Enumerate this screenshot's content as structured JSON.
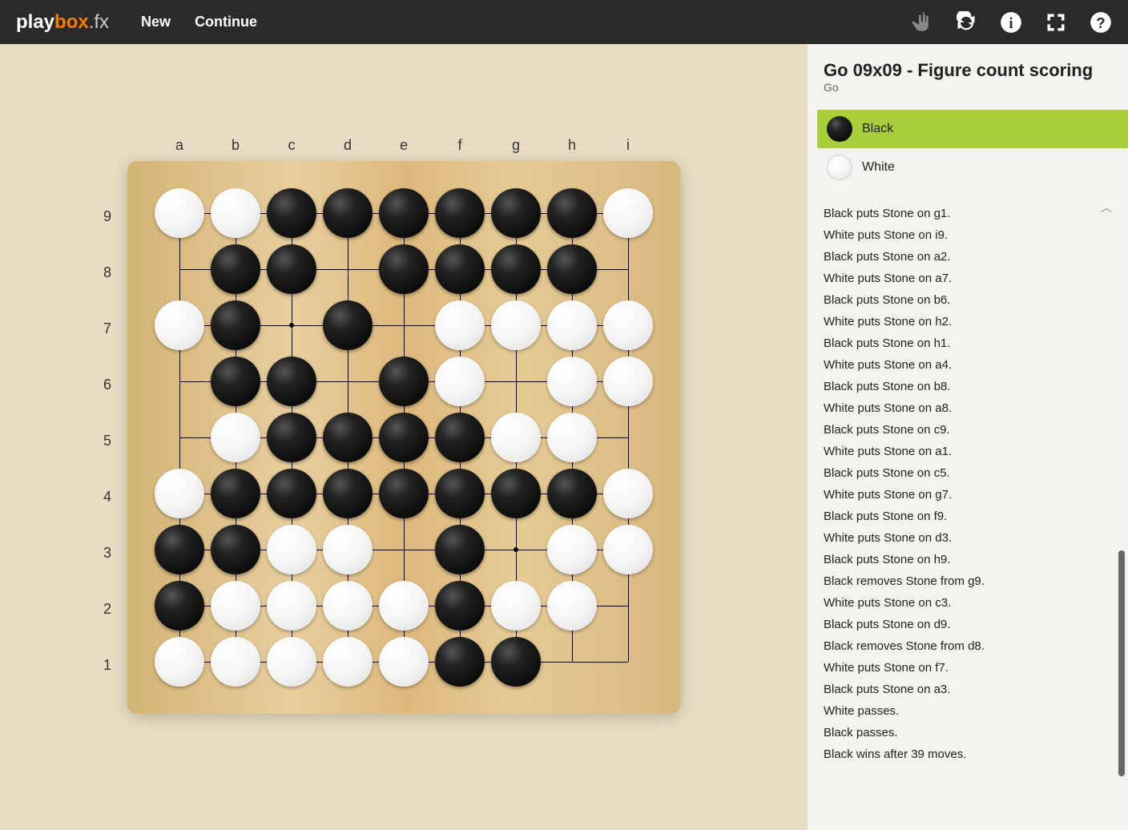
{
  "logo": {
    "part1": "play",
    "part2": "box",
    "part3": ".fx"
  },
  "nav": {
    "new": "New",
    "continue": "Continue"
  },
  "game": {
    "title": "Go 09x09 - Figure count scoring",
    "subtitle": "Go"
  },
  "players": {
    "black": "Black",
    "white": "White"
  },
  "board": {
    "cols": [
      "a",
      "b",
      "c",
      "d",
      "e",
      "f",
      "g",
      "h",
      "i"
    ],
    "rows": [
      "9",
      "8",
      "7",
      "6",
      "5",
      "4",
      "3",
      "2",
      "1"
    ],
    "stars": [
      [
        2,
        2
      ],
      [
        2,
        6
      ],
      [
        4,
        4
      ],
      [
        6,
        2
      ],
      [
        6,
        6
      ]
    ],
    "stones": [
      {
        "c": 0,
        "r": 0,
        "k": "white"
      },
      {
        "c": 1,
        "r": 0,
        "k": "white"
      },
      {
        "c": 2,
        "r": 0,
        "k": "black"
      },
      {
        "c": 3,
        "r": 0,
        "k": "black"
      },
      {
        "c": 4,
        "r": 0,
        "k": "black"
      },
      {
        "c": 5,
        "r": 0,
        "k": "black"
      },
      {
        "c": 6,
        "r": 0,
        "k": "black"
      },
      {
        "c": 7,
        "r": 0,
        "k": "black"
      },
      {
        "c": 8,
        "r": 0,
        "k": "white"
      },
      {
        "c": 1,
        "r": 1,
        "k": "black"
      },
      {
        "c": 2,
        "r": 1,
        "k": "black"
      },
      {
        "c": 4,
        "r": 1,
        "k": "black"
      },
      {
        "c": 5,
        "r": 1,
        "k": "black"
      },
      {
        "c": 6,
        "r": 1,
        "k": "black"
      },
      {
        "c": 7,
        "r": 1,
        "k": "black"
      },
      {
        "c": 0,
        "r": 2,
        "k": "white"
      },
      {
        "c": 1,
        "r": 2,
        "k": "black"
      },
      {
        "c": 3,
        "r": 2,
        "k": "black"
      },
      {
        "c": 5,
        "r": 2,
        "k": "white"
      },
      {
        "c": 6,
        "r": 2,
        "k": "white"
      },
      {
        "c": 7,
        "r": 2,
        "k": "white"
      },
      {
        "c": 8,
        "r": 2,
        "k": "white"
      },
      {
        "c": 1,
        "r": 3,
        "k": "black"
      },
      {
        "c": 2,
        "r": 3,
        "k": "black"
      },
      {
        "c": 4,
        "r": 3,
        "k": "black"
      },
      {
        "c": 5,
        "r": 3,
        "k": "white"
      },
      {
        "c": 7,
        "r": 3,
        "k": "white"
      },
      {
        "c": 8,
        "r": 3,
        "k": "white"
      },
      {
        "c": 1,
        "r": 4,
        "k": "white"
      },
      {
        "c": 2,
        "r": 4,
        "k": "black"
      },
      {
        "c": 3,
        "r": 4,
        "k": "black"
      },
      {
        "c": 4,
        "r": 4,
        "k": "black"
      },
      {
        "c": 5,
        "r": 4,
        "k": "black"
      },
      {
        "c": 6,
        "r": 4,
        "k": "white"
      },
      {
        "c": 7,
        "r": 4,
        "k": "white"
      },
      {
        "c": 0,
        "r": 5,
        "k": "white"
      },
      {
        "c": 1,
        "r": 5,
        "k": "black"
      },
      {
        "c": 2,
        "r": 5,
        "k": "black"
      },
      {
        "c": 3,
        "r": 5,
        "k": "black"
      },
      {
        "c": 4,
        "r": 5,
        "k": "black"
      },
      {
        "c": 5,
        "r": 5,
        "k": "black"
      },
      {
        "c": 6,
        "r": 5,
        "k": "black"
      },
      {
        "c": 7,
        "r": 5,
        "k": "black"
      },
      {
        "c": 8,
        "r": 5,
        "k": "white"
      },
      {
        "c": 0,
        "r": 6,
        "k": "black"
      },
      {
        "c": 1,
        "r": 6,
        "k": "black"
      },
      {
        "c": 2,
        "r": 6,
        "k": "white"
      },
      {
        "c": 3,
        "r": 6,
        "k": "white"
      },
      {
        "c": 5,
        "r": 6,
        "k": "black"
      },
      {
        "c": 7,
        "r": 6,
        "k": "white"
      },
      {
        "c": 8,
        "r": 6,
        "k": "white"
      },
      {
        "c": 0,
        "r": 7,
        "k": "black"
      },
      {
        "c": 1,
        "r": 7,
        "k": "white"
      },
      {
        "c": 2,
        "r": 7,
        "k": "white"
      },
      {
        "c": 3,
        "r": 7,
        "k": "white"
      },
      {
        "c": 4,
        "r": 7,
        "k": "white"
      },
      {
        "c": 5,
        "r": 7,
        "k": "black"
      },
      {
        "c": 6,
        "r": 7,
        "k": "white"
      },
      {
        "c": 7,
        "r": 7,
        "k": "white"
      },
      {
        "c": 0,
        "r": 8,
        "k": "white"
      },
      {
        "c": 1,
        "r": 8,
        "k": "white"
      },
      {
        "c": 2,
        "r": 8,
        "k": "white"
      },
      {
        "c": 3,
        "r": 8,
        "k": "white"
      },
      {
        "c": 4,
        "r": 8,
        "k": "white"
      },
      {
        "c": 5,
        "r": 8,
        "k": "black"
      },
      {
        "c": 6,
        "r": 8,
        "k": "black"
      }
    ]
  },
  "moves": [
    "Black puts Stone on g1.",
    "White puts Stone on i9.",
    "Black puts Stone on a2.",
    "White puts Stone on a7.",
    "Black puts Stone on b6.",
    "White puts Stone on h2.",
    "Black puts Stone on h1.",
    "White puts Stone on a4.",
    "Black puts Stone on b8.",
    "White puts Stone on a8.",
    "Black puts Stone on c9.",
    "White puts Stone on a1.",
    "Black puts Stone on c5.",
    "White puts Stone on g7.",
    "Black puts Stone on f9.",
    "White puts Stone on d3.",
    "Black puts Stone on h9.",
    "Black removes Stone from g9.",
    "White puts Stone on c3.",
    "Black puts Stone on d9.",
    "Black removes Stone from d8.",
    "White puts Stone on f7.",
    "Black puts Stone on a3.",
    "White passes.",
    "Black passes.",
    "Black wins after 39 moves."
  ]
}
